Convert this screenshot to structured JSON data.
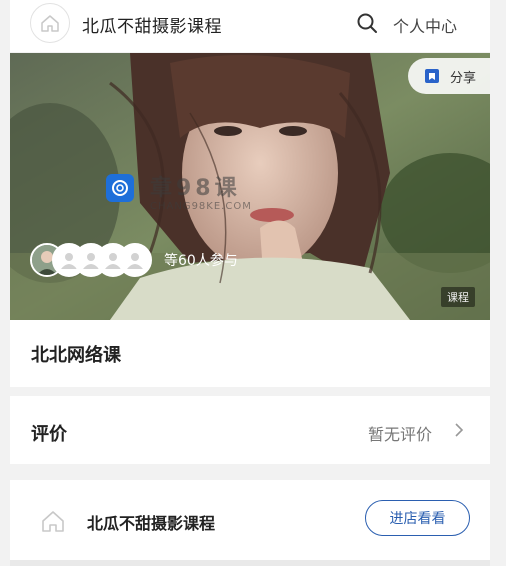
{
  "header": {
    "shop_name": "北瓜不甜摄影课程",
    "search_icon": "search-icon",
    "personal_center": "个人中心"
  },
  "hero": {
    "share_label": "分享",
    "watermark_title": "章98课",
    "watermark_url": "CHANG98KE.COM",
    "participants_text": "等60人参与",
    "type_badge": "课程"
  },
  "course": {
    "title": "北北网络课"
  },
  "review": {
    "label": "评价",
    "status": "暂无评价"
  },
  "shop": {
    "name": "北瓜不甜摄影课程",
    "enter_label": "进店看看"
  },
  "colors": {
    "accent": "#2b5fb0",
    "share_icon": "#2a63c9"
  }
}
